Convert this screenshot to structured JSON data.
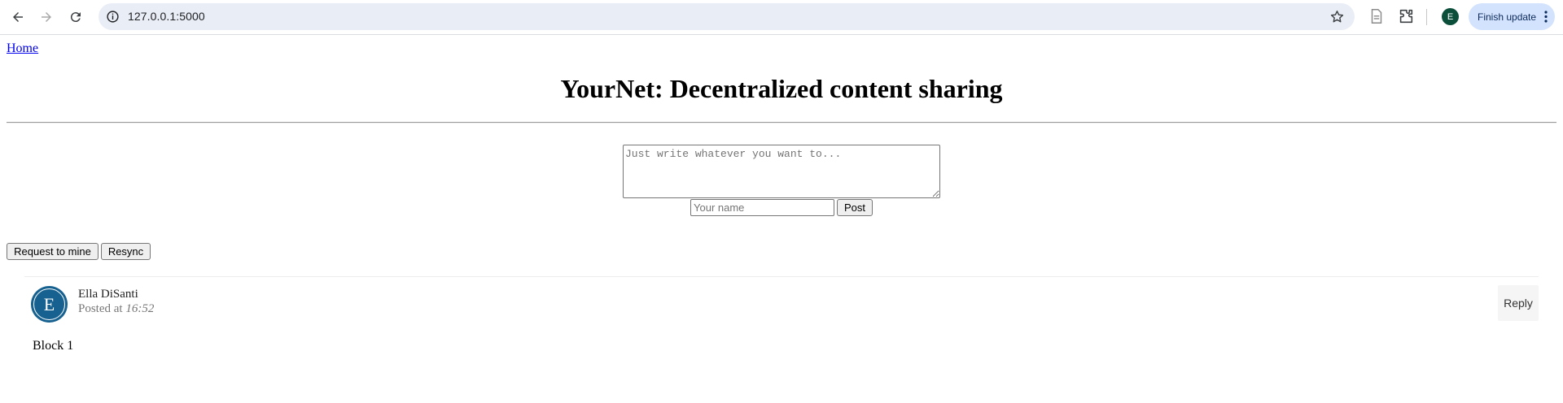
{
  "browser": {
    "url": "127.0.0.1:5000",
    "profile_initial": "E",
    "update_label": "Finish update",
    "icons": [
      "back-arrow-icon",
      "forward-arrow-icon",
      "reload-icon",
      "info-icon",
      "star-icon",
      "reading-list-icon",
      "extensions-icon",
      "kebab-menu-icon"
    ],
    "accent_color": "#d3e3fd"
  },
  "page": {
    "home_link": "Home",
    "title": "YourNet: Decentralized content sharing"
  },
  "compose": {
    "text_placeholder": "Just write whatever you want to...",
    "name_placeholder": "Your name",
    "post_label": "Post"
  },
  "actions": {
    "mine_label": "Request to mine",
    "resync_label": "Resync"
  },
  "posts": [
    {
      "avatar_initial": "E",
      "avatar_color": "#16618f",
      "author": "Ella DiSanti",
      "posted_prefix": "Posted at",
      "time": "16:52",
      "reply_label": "Reply",
      "content": "Block 1"
    }
  ]
}
